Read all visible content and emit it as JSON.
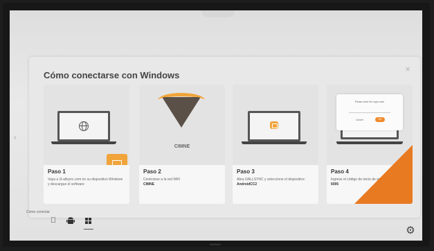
{
  "dialog": {
    "title": "Cómo conectarse con Windows",
    "close_icon": "close-icon"
  },
  "steps": [
    {
      "title": "Paso 1",
      "text": "Vaya a i3-allsync.com en su dispositivo Windows y descargue el software",
      "icon": "globe-icon"
    },
    {
      "title": "Paso 2",
      "text": "Conéctese a la red WiFi",
      "bold": "CIMNE",
      "network_name": "CIMNE",
      "icon": "wifi-icon"
    },
    {
      "title": "Paso 3",
      "text": "Abra i3ALLSYNC y seleccione el dispositivo:",
      "bold": "AndroidCC2",
      "icon": "cast-icon"
    },
    {
      "title": "Paso 4",
      "text": "Ingrese el código de inicio de sesión",
      "bold": "6095",
      "popup": {
        "title": "Please enter the login code",
        "cancel": "Cancel",
        "ok": "OK"
      }
    }
  ],
  "footer": {
    "how_to_label": "Cómo conectar",
    "os_options": [
      "apple-icon",
      "android-icon",
      "windows-icon"
    ],
    "selected_os": "windows-icon"
  },
  "brand": "VERSION",
  "colors": {
    "accent": "#f0a43a",
    "corner": "#e87a22",
    "dialog_bg": "#e8e8e8"
  }
}
